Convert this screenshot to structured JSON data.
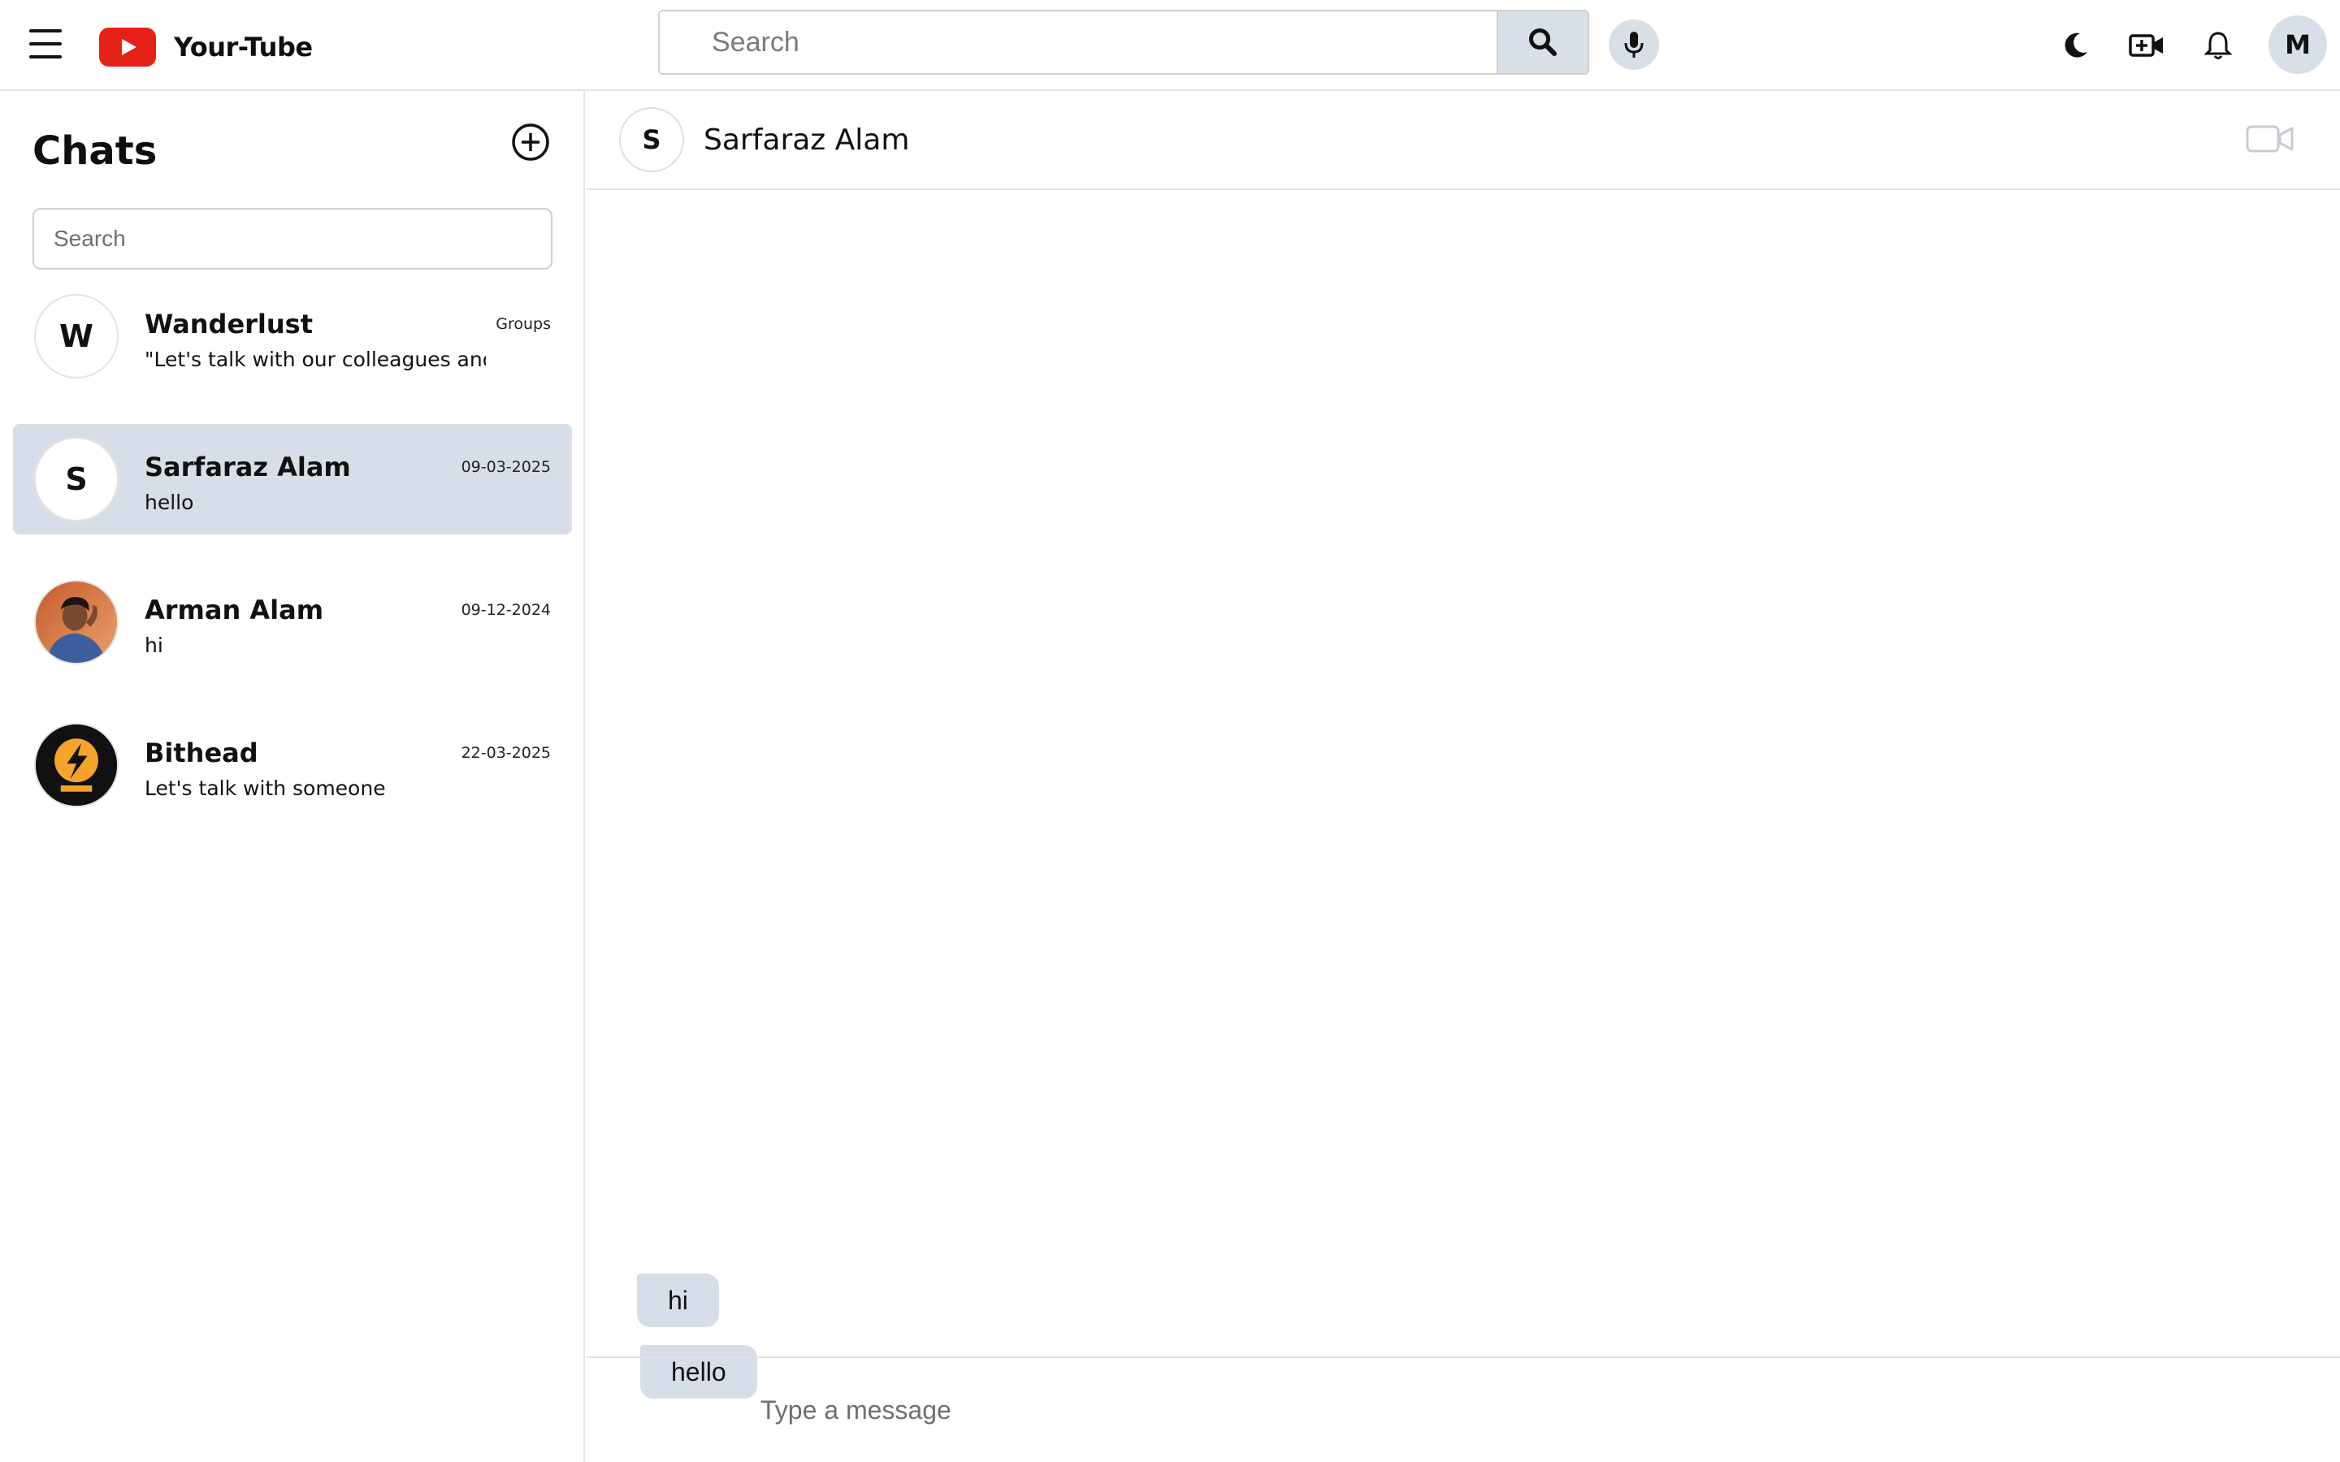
{
  "app": {
    "name": "Your-Tube",
    "brand_color": "#e62117"
  },
  "header": {
    "search_placeholder": "Search",
    "icons": [
      "menu-icon",
      "search-icon",
      "mic-icon",
      "moon-icon",
      "video-add-icon",
      "bell-icon"
    ],
    "avatar_initial": "M"
  },
  "sidebar": {
    "title": "Chats",
    "search_placeholder": "Search",
    "chats": [
      {
        "name": "Wanderlust",
        "preview": "\"Let's talk with our colleagues and...",
        "meta": "Groups",
        "initial": "W",
        "avatar": "letter",
        "active": false
      },
      {
        "name": "Sarfaraz Alam",
        "preview": "hello",
        "meta": "09-03-2025",
        "initial": "S",
        "avatar": "letter",
        "active": true
      },
      {
        "name": "Arman Alam",
        "preview": "hi",
        "meta": "09-12-2024",
        "initial": "",
        "avatar": "photo",
        "active": false
      },
      {
        "name": "Bithead",
        "preview": "Let's talk with someone",
        "meta": "22-03-2025",
        "initial": "",
        "avatar": "bithead-logo",
        "active": false
      }
    ]
  },
  "conversation": {
    "contact_name": "Sarfaraz Alam",
    "contact_initial": "S",
    "messages": [
      {
        "text": "hi"
      },
      {
        "text": "hello"
      }
    ],
    "composer_placeholder": "Type a message"
  },
  "colors": {
    "accent_bubble": "#d8dee7",
    "active_row": "#d8dee7",
    "bithead_orange": "#f5a32a"
  }
}
